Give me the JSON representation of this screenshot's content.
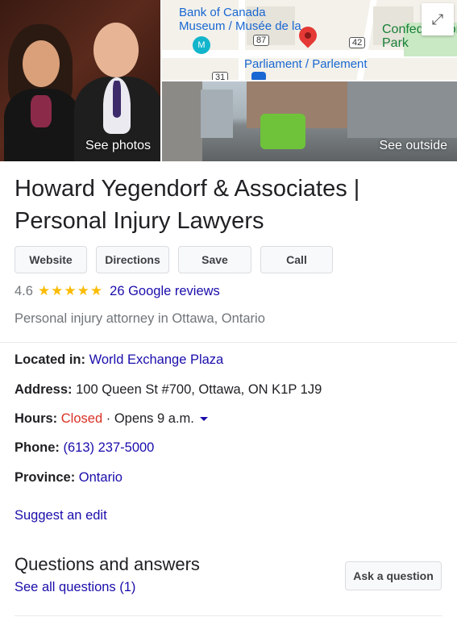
{
  "photos": {
    "main_label": "See photos",
    "street_label": "See outside"
  },
  "map": {
    "labels": {
      "museum": "Bank of Canada\nMuseum / Musée de la...",
      "parliament": "Parliament / Parlement",
      "park": "Confederation\nPark",
      "route87": "87",
      "route42": "42",
      "route31": "31"
    },
    "icons": [
      "expand-icon",
      "map-pin-icon",
      "museum-icon",
      "metro-icon"
    ]
  },
  "business": {
    "name": "Howard Yegendorf & Associates | Personal Injury Lawyers",
    "rating": "4.6",
    "stars_glyph": "★★★★★",
    "reviews": "26 Google reviews",
    "category": "Personal injury attorney in Ottawa, Ontario"
  },
  "actions": {
    "website": "Website",
    "directions": "Directions",
    "save": "Save",
    "call": "Call"
  },
  "details": {
    "located_label": "Located in:",
    "located_value": "World Exchange Plaza",
    "address_label": "Address:",
    "address_value": "100 Queen St #700, Ottawa, ON K1P 1J9",
    "hours_label": "Hours:",
    "hours_status": "Closed",
    "hours_open": "· Opens 9 a.m.",
    "phone_label": "Phone:",
    "phone_value": "(613) 237-5000",
    "province_label": "Province:",
    "province_value": "Ontario"
  },
  "suggest_edit": "Suggest an edit",
  "qa": {
    "title": "Questions and answers",
    "see_all": "See all questions (1)",
    "ask_button": "Ask a question"
  },
  "colors": {
    "link": "#1a0dab",
    "closed": "#d93025",
    "star": "#fbbc04",
    "muted": "#70757a"
  }
}
